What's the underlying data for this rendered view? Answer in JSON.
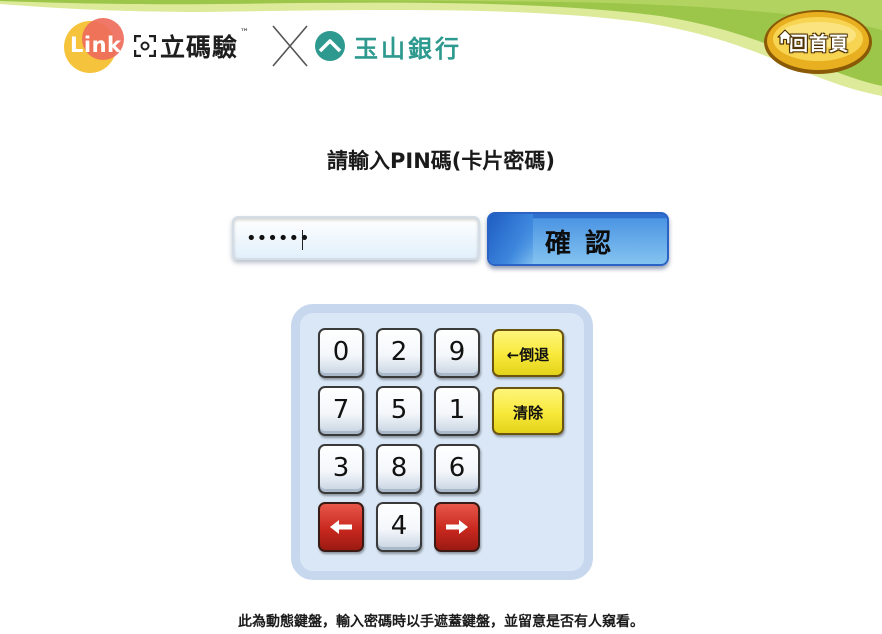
{
  "header": {
    "link_logo_text": "Link",
    "scan_brand": "立碼驗",
    "scan_brand_mark": "™",
    "bank_name": "玉山銀行",
    "home_button_label": "回首頁",
    "colors": {
      "header_wave_light": "#cfe47a",
      "header_wave_green": "#8bbf3a",
      "home_button_gold": "#c8960e",
      "bank_teal": "#2e9a8f"
    }
  },
  "prompt": {
    "text": "請輸入PIN碼(卡片密碼)"
  },
  "pin": {
    "masked_value": "••••••",
    "confirm_label": "確認"
  },
  "keypad": {
    "digits": [
      "0",
      "2",
      "9",
      "7",
      "5",
      "1",
      "3",
      "8",
      "6",
      "4"
    ],
    "backspace_label": "←倒退",
    "clear_label": "清除",
    "left_arrow_icon": "arrow-left-icon",
    "right_arrow_icon": "arrow-right-icon"
  },
  "note": {
    "text": "此為動態鍵盤，輸入密碼時以手遮蓋鍵盤，並留意是否有人窺看。"
  }
}
